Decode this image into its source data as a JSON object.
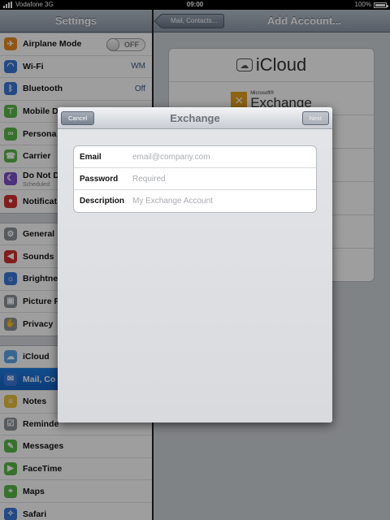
{
  "status": {
    "carrier": "Vodafone 3G",
    "time": "09:00",
    "battery": "100%"
  },
  "master": {
    "title": "Settings",
    "groups": [
      [
        {
          "label": "Airplane Mode",
          "icon": "airplane-icon",
          "color": "#e98b1d",
          "toggle": "OFF"
        },
        {
          "label": "Wi-Fi",
          "icon": "wifi-icon",
          "color": "#3b78d9",
          "value": "WM"
        },
        {
          "label": "Bluetooth",
          "icon": "bluetooth-icon",
          "color": "#3b78d9",
          "value": "Off"
        },
        {
          "label": "Mobile D",
          "icon": "antenna-icon",
          "color": "#59b948"
        },
        {
          "label": "Persona",
          "icon": "link-icon",
          "color": "#59b948"
        },
        {
          "label": "Carrier",
          "icon": "phone-icon",
          "color": "#59b948"
        },
        {
          "label": "Do Not D",
          "sub": "Scheduled",
          "icon": "moon-icon",
          "color": "#7b4fc9"
        },
        {
          "label": "Notificat",
          "icon": "notifications-icon",
          "color": "#d0312d"
        }
      ],
      [
        {
          "label": "General",
          "icon": "gear-icon",
          "color": "#8c939c"
        },
        {
          "label": "Sounds",
          "icon": "speaker-icon",
          "color": "#d0312d"
        },
        {
          "label": "Brightne",
          "icon": "brightness-icon",
          "color": "#3b78d9"
        },
        {
          "label": "Picture F",
          "icon": "picture-frame-icon",
          "color": "#8c939c"
        },
        {
          "label": "Privacy",
          "icon": "hand-icon",
          "color": "#8c939c"
        }
      ],
      [
        {
          "label": "iCloud",
          "icon": "cloud-icon",
          "color": "#5aa7e8"
        },
        {
          "label": "Mail, Co",
          "icon": "mail-icon",
          "color": "#3b78d9",
          "selected": true
        },
        {
          "label": "Notes",
          "icon": "notes-icon",
          "color": "#e8c13c"
        },
        {
          "label": "Reminde",
          "icon": "reminders-icon",
          "color": "#8c939c"
        },
        {
          "label": "Messages",
          "icon": "messages-icon",
          "color": "#59b948"
        },
        {
          "label": "FaceTime",
          "icon": "video-icon",
          "color": "#59b948"
        },
        {
          "label": "Maps",
          "icon": "map-icon",
          "color": "#59b948"
        },
        {
          "label": "Safari",
          "icon": "compass-icon",
          "color": "#3b78d9"
        }
      ]
    ]
  },
  "detail": {
    "back": "Mail, Contacts...",
    "title": "Add Account...",
    "icloud": "iCloud",
    "exchange_small": "Microsoft®",
    "exchange": "Exchange"
  },
  "modal": {
    "title": "Exchange",
    "cancel": "Cancel",
    "next": "Next",
    "fields": [
      {
        "label": "Email",
        "placeholder": "email@company.com"
      },
      {
        "label": "Password",
        "placeholder": "Required"
      },
      {
        "label": "Description",
        "placeholder": "My Exchange Account"
      }
    ]
  }
}
